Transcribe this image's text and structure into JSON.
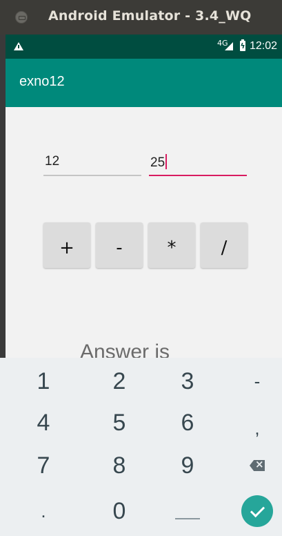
{
  "window": {
    "title": "Android Emulator - 3.4_WQ"
  },
  "status_bar": {
    "network": "4G",
    "time": "12:02"
  },
  "app_bar": {
    "title": "exno12"
  },
  "inputs": {
    "first_value": "12",
    "second_value": "25"
  },
  "operators": [
    "+",
    "-",
    "*",
    "/"
  ],
  "answer_label": "Answer is",
  "keyboard": {
    "rows": [
      [
        "1",
        "2",
        "3",
        "-"
      ],
      [
        "4",
        "5",
        "6",
        ","
      ],
      [
        "7",
        "8",
        "9"
      ],
      [
        ".",
        "0"
      ]
    ]
  },
  "colors": {
    "status_bar": "#004d40",
    "app_bar": "#00897b",
    "accent": "#d81b60",
    "done_key": "#26a69a"
  }
}
